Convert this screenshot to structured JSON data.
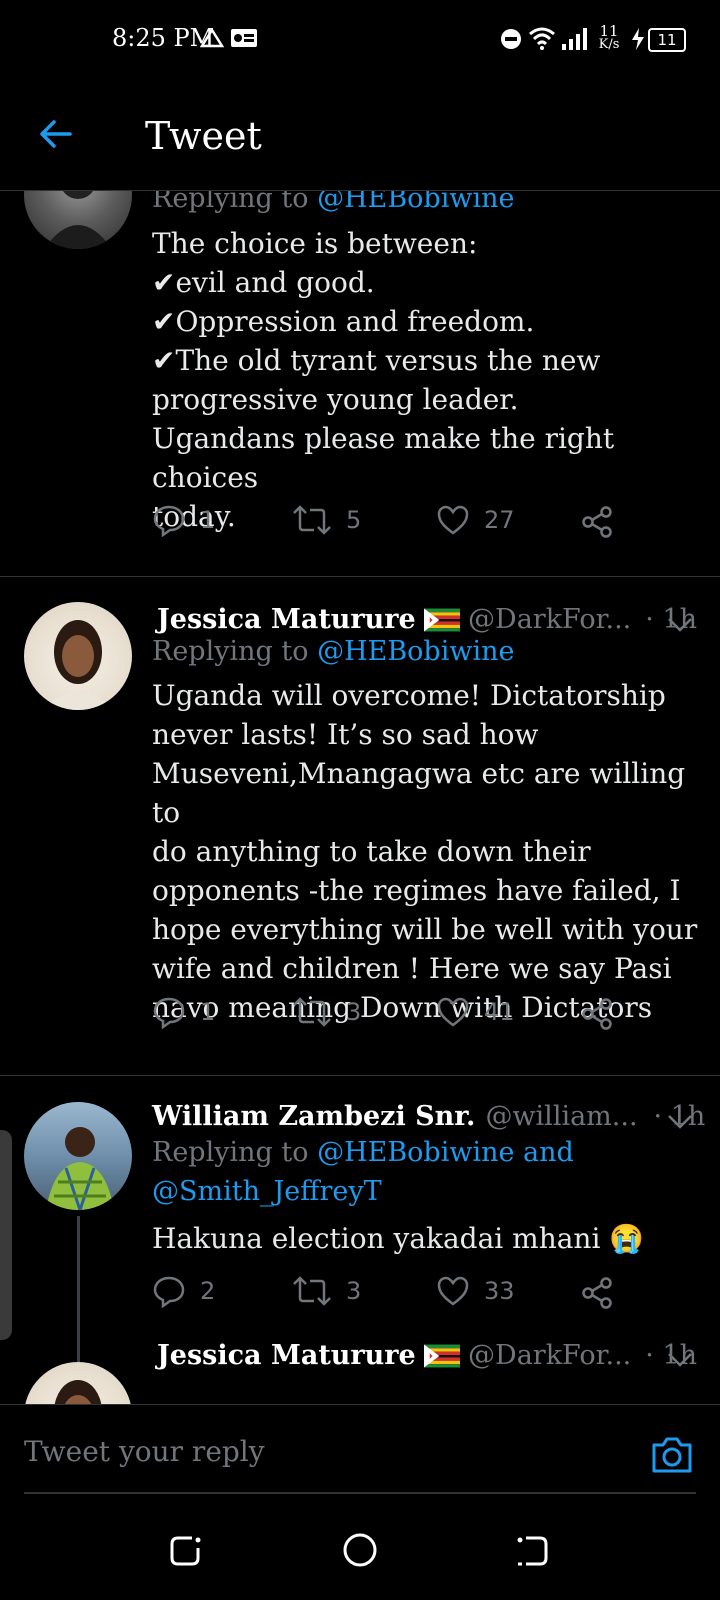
{
  "status_bar": {
    "time": "8:25 PM",
    "speed_value": "11",
    "speed_unit": "K/s",
    "battery": "11"
  },
  "header": {
    "title": "Tweet"
  },
  "tweets": [
    {
      "reply_prefix": "Replying to ",
      "reply_to": "@HEBobiwine",
      "lines": [
        "The choice is between:",
        "✔evil and good.",
        "✔Oppression and freedom.",
        "✔The old tyrant versus the new",
        "progressive young leader.",
        "Ugandans please make the right choices",
        "today."
      ],
      "replies": "1",
      "retweets": "5",
      "likes": "27"
    },
    {
      "name": "Jessica Maturure",
      "handle": "@DarkFor...",
      "time": "· 1h",
      "reply_prefix": "Replying to ",
      "reply_to": "@HEBobiwine",
      "lines": [
        "Uganda will overcome! Dictatorship",
        "never lasts! It’s so sad how",
        "Museveni,Mnangagwa etc are willing to",
        "do anything to take down their",
        "opponents -the regimes have failed, I",
        "hope everything will be well with your",
        "wife and children ! Here we say Pasi",
        "navo meaning Down with Dictators"
      ],
      "replies": "1",
      "retweets": "3",
      "likes": "41"
    },
    {
      "name": "William Zambezi Snr.",
      "handle": "@william...",
      "time": "· 1h",
      "reply_prefix": "Replying to ",
      "reply_to": "@HEBobiwine and",
      "reply_to_2": "@Smith_JeffreyT",
      "text": "Hakuna election yakadai mhani 😭",
      "replies": "2",
      "retweets": "3",
      "likes": "33"
    },
    {
      "name": "Jessica Maturure",
      "handle": "@DarkFor...",
      "time": "· 1h"
    }
  ],
  "reply_bar": {
    "placeholder": "Tweet your reply"
  },
  "colors": {
    "accent": "#1d9bf0",
    "muted": "#71767b",
    "text": "#e7e9ea"
  }
}
